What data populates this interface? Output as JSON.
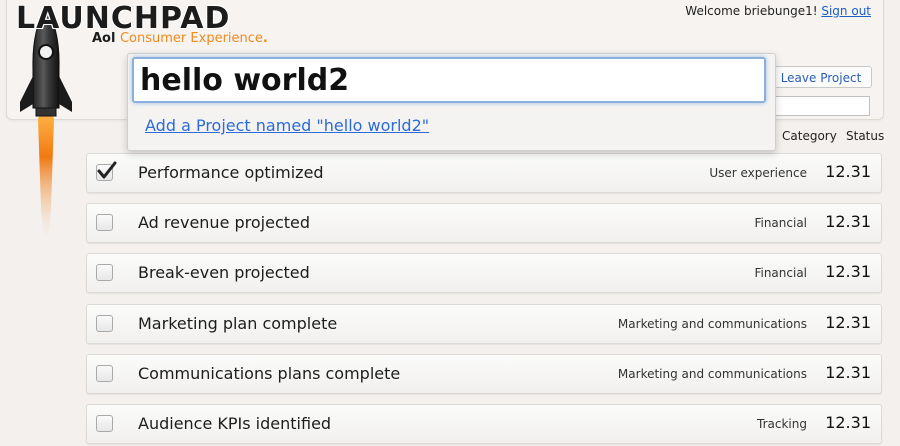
{
  "brand": {
    "logo_text": "LAUNCHPAD",
    "sub_aol": "Aol",
    "sub_title": "Consumer Experience",
    "sub_dot": ".",
    "accent_color": "#f08a1c"
  },
  "user": {
    "welcome_text": "Welcome briebunge1!",
    "sign_out_label": "Sign out"
  },
  "project": {
    "leave_label": "Leave Project",
    "side_input_value": ""
  },
  "search": {
    "value": "hello world2",
    "suggestion": "Add a Project named \"hello world2\""
  },
  "columns": {
    "category": "Category",
    "status": "Status"
  },
  "items": [
    {
      "title": "Performance optimized",
      "category": "User experience",
      "status": "12.31",
      "checked": true
    },
    {
      "title": "Ad revenue projected",
      "category": "Financial",
      "status": "12.31",
      "checked": false
    },
    {
      "title": "Break-even projected",
      "category": "Financial",
      "status": "12.31",
      "checked": false
    },
    {
      "title": "Marketing plan complete",
      "category": "Marketing and communications",
      "status": "12.31",
      "checked": false
    },
    {
      "title": "Communications plans complete",
      "category": "Marketing and communications",
      "status": "12.31",
      "checked": false
    },
    {
      "title": "Audience KPIs identified",
      "category": "Tracking",
      "status": "12.31",
      "checked": false
    }
  ]
}
